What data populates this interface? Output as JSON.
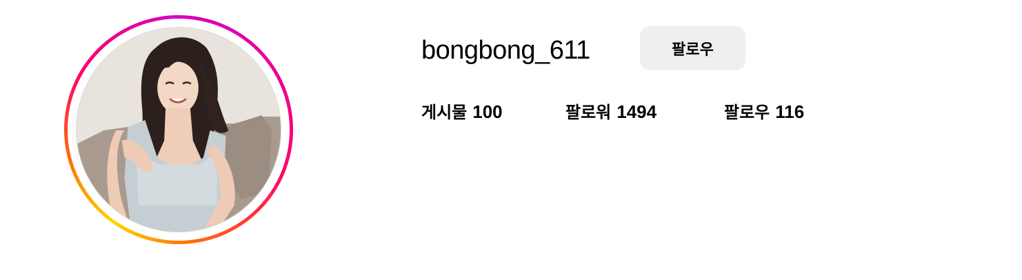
{
  "profile": {
    "username": "bongbong_611",
    "follow_label": "팔로우",
    "avatar_alt": "profile photo"
  },
  "stats": {
    "posts": {
      "label": "게시물",
      "value": "100"
    },
    "followers": {
      "label": "팔로워",
      "value": "1494"
    },
    "following": {
      "label": "팔로우",
      "value": "116"
    }
  },
  "colors": {
    "button_bg": "#efefef",
    "story_ring_start": "#d300c5",
    "story_ring_mid": "#ff0069",
    "story_ring_end": "#ffd600"
  }
}
